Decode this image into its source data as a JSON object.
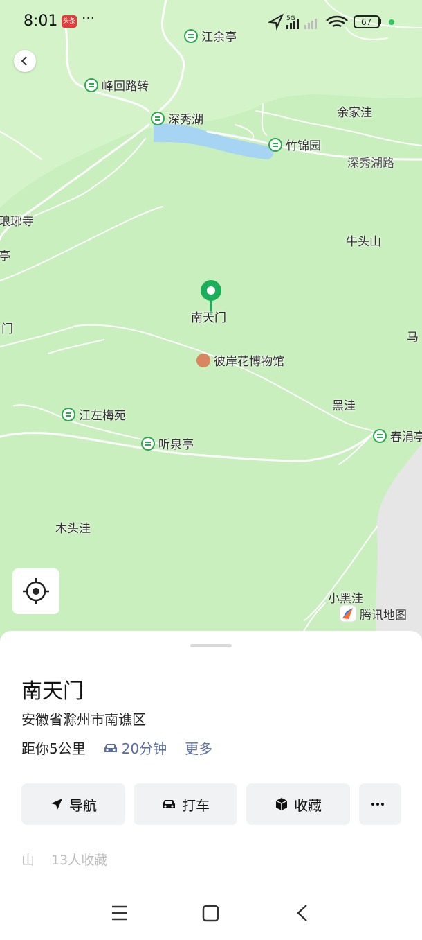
{
  "status_bar": {
    "time": "8:01",
    "app_badge": "头条",
    "more": "···",
    "network": "5G",
    "battery": "67"
  },
  "map": {
    "pois": [
      {
        "name": "江余亭"
      },
      {
        "name": "峰回路转"
      },
      {
        "name": "深秀湖"
      },
      {
        "name": "竹锦园"
      },
      {
        "name": "彼岸花博物馆"
      },
      {
        "name": "江左梅苑"
      },
      {
        "name": "听泉亭"
      },
      {
        "name": "春涓亭"
      }
    ],
    "places": {
      "yujiawa": "余家洼",
      "shenxiuhu_road": "深秀湖路",
      "langyasi": "琅琊寺",
      "ting": "亭",
      "niutoushan": "牛头山",
      "men": "门",
      "ma": "马",
      "heiwa": "黑洼",
      "mutouwa": "木头洼",
      "xiaoheiwa": "小黑洼"
    },
    "selected_marker": "南天门",
    "brand": "腾讯地图",
    "colors": {
      "land": "#c9efbe",
      "water": "#a6d4f2",
      "road": "#ffffff",
      "marker": "#1aad5a"
    }
  },
  "sheet": {
    "title": "南天门",
    "address": "安徽省滁州市南谯区",
    "distance": "距你5公里",
    "drive_time": "20分钟",
    "more": "更多",
    "actions": {
      "navigate": "导航",
      "taxi": "打车",
      "favorite": "收藏",
      "more_icon": "ellipsis-icon"
    },
    "category": "山",
    "favorites_count": "13人收藏"
  }
}
